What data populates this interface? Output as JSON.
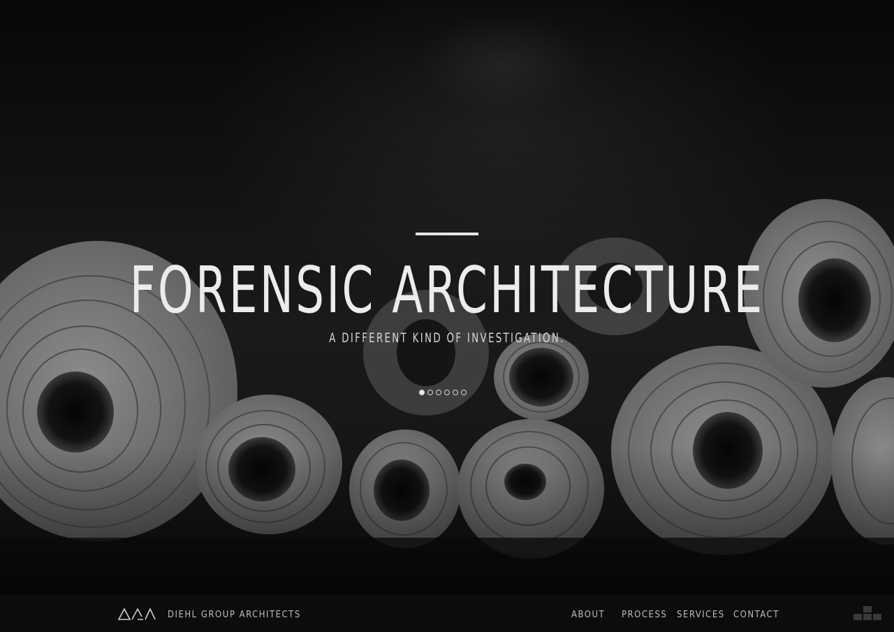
{
  "hero": {
    "title": "FORENSIC ARCHITECTURE",
    "subtitle": "A DIFFERENT KIND OF INVESTIGATION.",
    "slides": {
      "count": 6,
      "active": 1
    }
  },
  "footer": {
    "brand": "DIEHL GROUP ARCHITECTS",
    "logo_icon": "dga-triangles-logo-icon",
    "nav": {
      "about": "ABOUT",
      "process": "PROCESS",
      "services": "SERVICES",
      "contact": "CONTACT"
    },
    "menu_icon": "grid-blocks-icon"
  },
  "colors": {
    "text": "#ececec",
    "nav_text": "#bdbdbd",
    "footer_bg": "#0c0c0c"
  }
}
